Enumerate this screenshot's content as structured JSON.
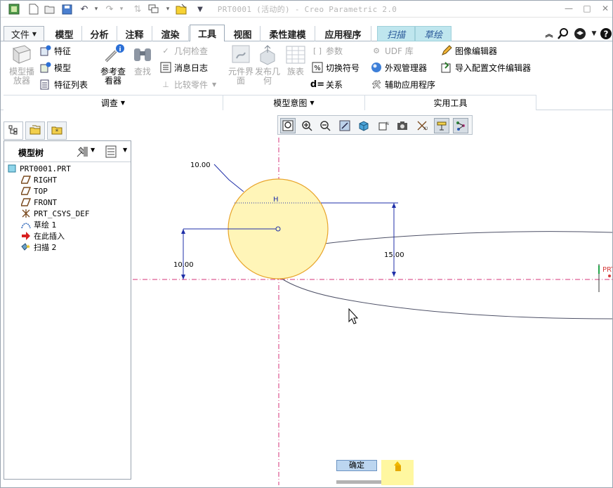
{
  "window": {
    "title": "PRT0001 (活动的) - Creo Parametric 2.0",
    "minimize_icon": "minimize-icon",
    "restore_icon": "restore-icon",
    "close_icon": "close-icon"
  },
  "quick_access": [
    "app-icon",
    "new-icon",
    "open-icon",
    "save-icon",
    "undo-icon",
    "redo-icon",
    "regenerate-icon",
    "windows-icon",
    "close-window-icon",
    "customize-icon"
  ],
  "menu": {
    "file_label": "文件",
    "tabs": [
      {
        "label": "模型"
      },
      {
        "label": "分析"
      },
      {
        "label": "注释"
      },
      {
        "label": "渲染"
      },
      {
        "label": "工具",
        "active": true
      },
      {
        "label": "视图"
      },
      {
        "label": "柔性建模"
      },
      {
        "label": "应用程序"
      }
    ],
    "context_tabs": [
      {
        "label": "扫描"
      },
      {
        "label": "草绘"
      }
    ],
    "right_icons": [
      "collapse-ribbon-icon",
      "search-icon",
      "community-icon",
      "help-icon"
    ]
  },
  "ribbon": {
    "groups": {
      "investigate": "调查",
      "model_intent": "模型意图",
      "utilities": "实用工具"
    },
    "model_player": "模型播放器",
    "feature": "特征",
    "model": "模型",
    "feature_list": "特征列表",
    "reference_viewer": "参考查看器",
    "find": "查找",
    "geometry_check": "几何检查",
    "message_log": "消息日志",
    "compare_part": "比较零件",
    "component_interface": "元件界面",
    "publish_geometry": "发布几何",
    "family_table": "族表",
    "parameters": "参数",
    "switch_symbols": "切换符号",
    "relations": "关系",
    "udf_library": "UDF 库",
    "appearance_manager": "外观管理器",
    "auxiliary_app": "辅助应用程序",
    "image_editor": "图像编辑器",
    "import_config_editor": "导入配置文件编辑器"
  },
  "model_tree": {
    "title": "模型树",
    "items": [
      {
        "label": "PRT0001.PRT",
        "icon": "part-icon"
      },
      {
        "label": "RIGHT",
        "icon": "datum-plane-icon"
      },
      {
        "label": "TOP",
        "icon": "datum-plane-icon"
      },
      {
        "label": "FRONT",
        "icon": "datum-plane-icon"
      },
      {
        "label": "PRT_CSYS_DEF",
        "icon": "coordinate-system-icon"
      },
      {
        "label": "草绘 1",
        "icon": "sketch-icon"
      },
      {
        "label": "在此插入",
        "icon": "insert-here-icon"
      },
      {
        "label": "扫描 2",
        "icon": "sweep-icon"
      }
    ]
  },
  "graphics_toolbar": [
    "refit-icon",
    "zoom-in-icon",
    "zoom-out-icon",
    "repaint-icon",
    "display-style-icon",
    "saved-orientations-icon",
    "view-manager-icon",
    "datum-display-icon",
    "sketch-display-icon",
    "hide-constraints-icon"
  ],
  "sketch": {
    "dim_diameter": "10.00",
    "dim_height": "15.00",
    "dim_offset": "10.00",
    "constraint_h": "H",
    "csys_label": "PRT",
    "colors": {
      "circle_fill": "#fff5b8",
      "circle_stroke": "#e8a42a",
      "dimension": "#1f2fa8",
      "centerline": "#d4337a",
      "curve": "#4d5066"
    }
  },
  "dashboard_stub": {
    "ok_label": "确定"
  }
}
